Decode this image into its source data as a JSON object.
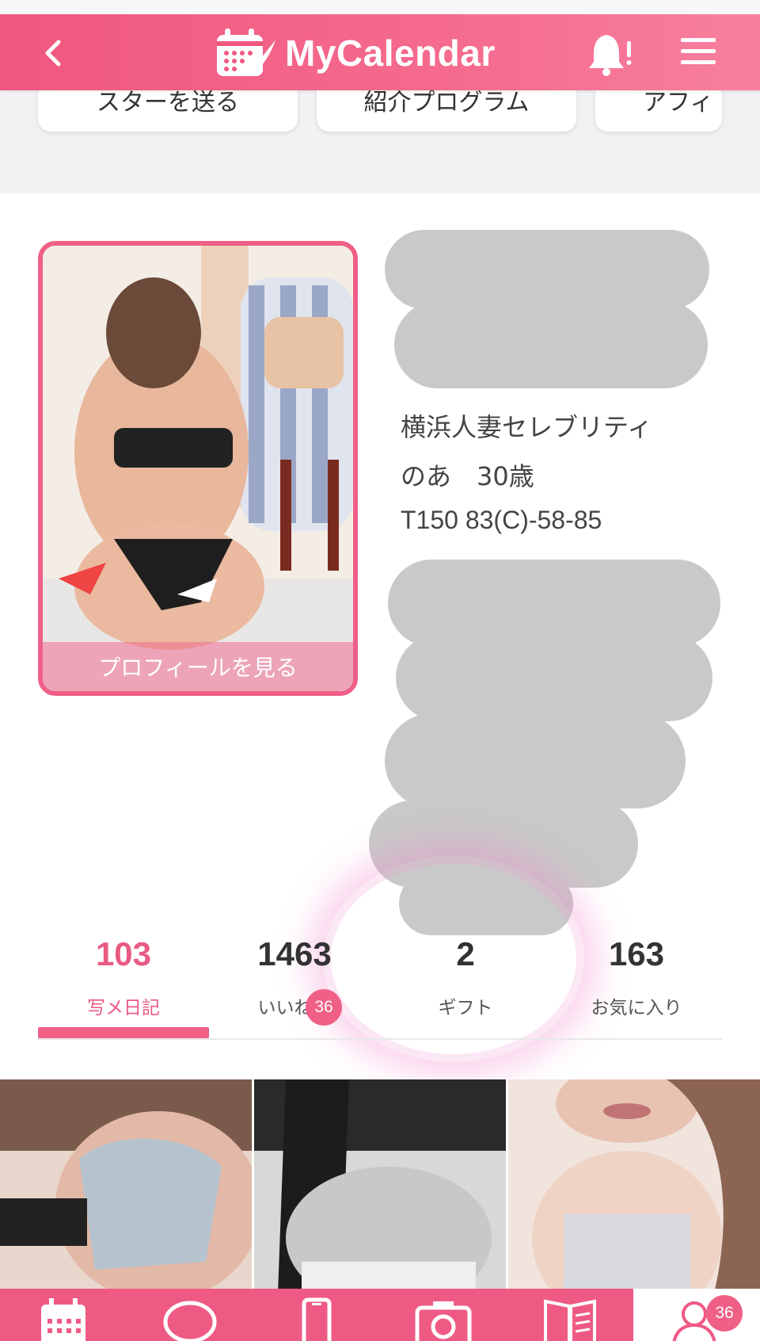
{
  "header": {
    "title": "MyCalendar",
    "brand_color": "#f0577f"
  },
  "pills": [
    {
      "label": "スターを送る"
    },
    {
      "label": "紹介プログラム"
    },
    {
      "label": "アフィ"
    }
  ],
  "profile": {
    "photo_label": "プロフィールを見る",
    "shop": "横浜人妻セレブリティ",
    "name_age": "のあ　30歳",
    "measurements": "T150 83(C)-58-85"
  },
  "stats": [
    {
      "value": "103",
      "label": "写メ日記",
      "active": true
    },
    {
      "value": "1463",
      "label": "いいね",
      "badge": "36"
    },
    {
      "value": "2",
      "label": "ギフト"
    },
    {
      "value": "163",
      "label": "お気に入り"
    }
  ],
  "bottom_nav": {
    "items": [
      "calendar-icon",
      "chat-icon",
      "phone-icon",
      "camera-icon",
      "diary-icon",
      "profile-icon"
    ],
    "profile_badge": "36"
  }
}
